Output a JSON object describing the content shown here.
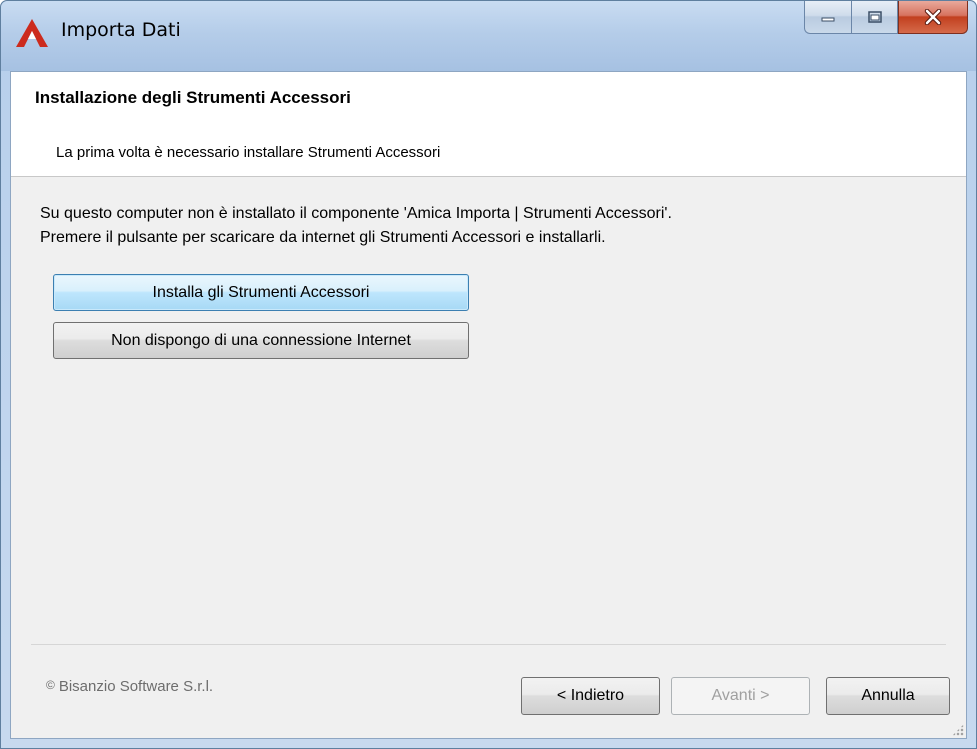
{
  "window": {
    "title": "Importa Dati",
    "accent_color": "#cc2b1d"
  },
  "header": {
    "title": "Installazione degli Strumenti Accessori",
    "subtitle": "La prima volta è necessario installare Strumenti Accessori"
  },
  "body": {
    "line1": "Su questo computer non è installato il componente 'Amica Importa | Strumenti Accessori'.",
    "line2": "Premere il pulsante per scaricare da internet gli Strumenti Accessori e installarli."
  },
  "actions": {
    "install_label": "Installa gli Strumenti Accessori",
    "no_internet_label": "Non dispongo di una connessione Internet"
  },
  "footer": {
    "copyright_symbol": "©",
    "copyright_text": "Bisanzio Software S.r.l.",
    "back_label": "< Indietro",
    "next_label": "Avanti >",
    "cancel_label": "Annulla"
  }
}
